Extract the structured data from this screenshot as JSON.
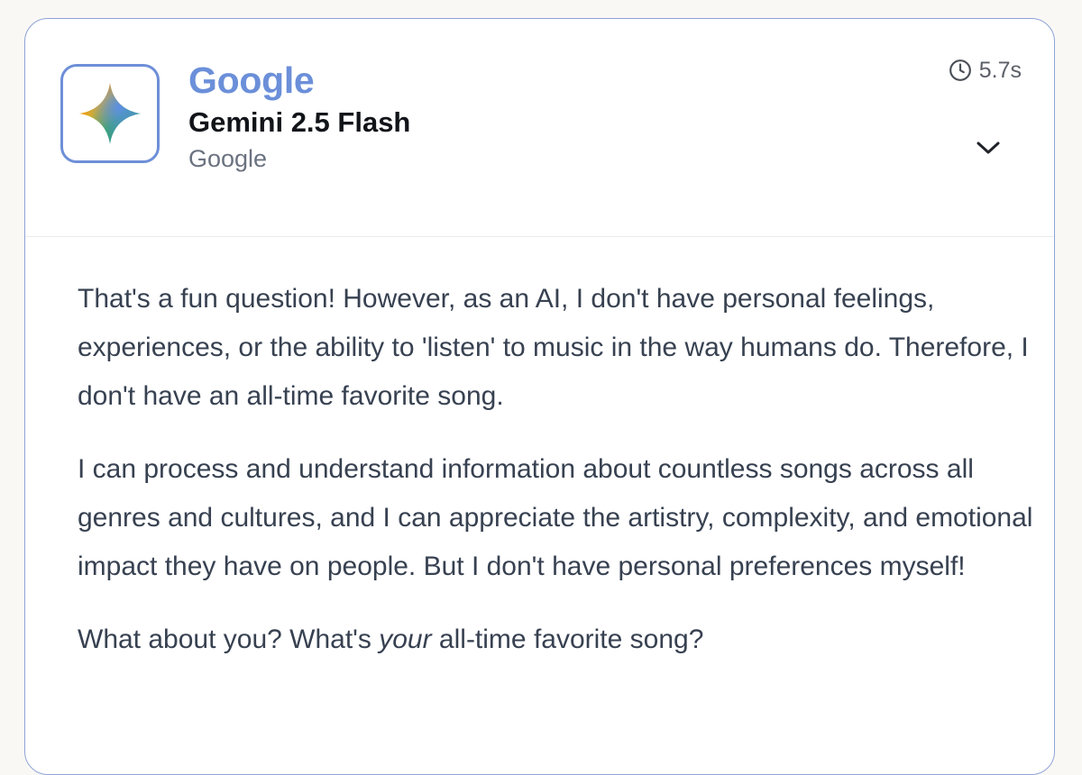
{
  "card": {
    "provider": "Google",
    "model": "Gemini 2.5 Flash",
    "organization": "Google",
    "elapsed": "5.7s",
    "logo_icon": "gemini-sparkle-icon",
    "time_icon": "clock-icon",
    "toggle_icon": "chevron-down-icon"
  },
  "response": {
    "paragraph_1": "That's a fun question! However, as an AI, I don't have personal feelings, experiences, or the ability to 'listen' to music in the way humans do. Therefore, I don't have an all-time favorite song.",
    "paragraph_2": "I can process and understand information about countless songs across all genres and cultures, and I can appreciate the artistry, complexity, and emotional impact they have on people. But I don't have personal preferences myself!",
    "paragraph_3_before": "What about you? What's ",
    "paragraph_3_emphasis": "your",
    "paragraph_3_after": " all-time favorite song?"
  },
  "colors": {
    "accent": "#6b8fd9",
    "border": "#8ea4d6",
    "body_text": "#374151"
  }
}
